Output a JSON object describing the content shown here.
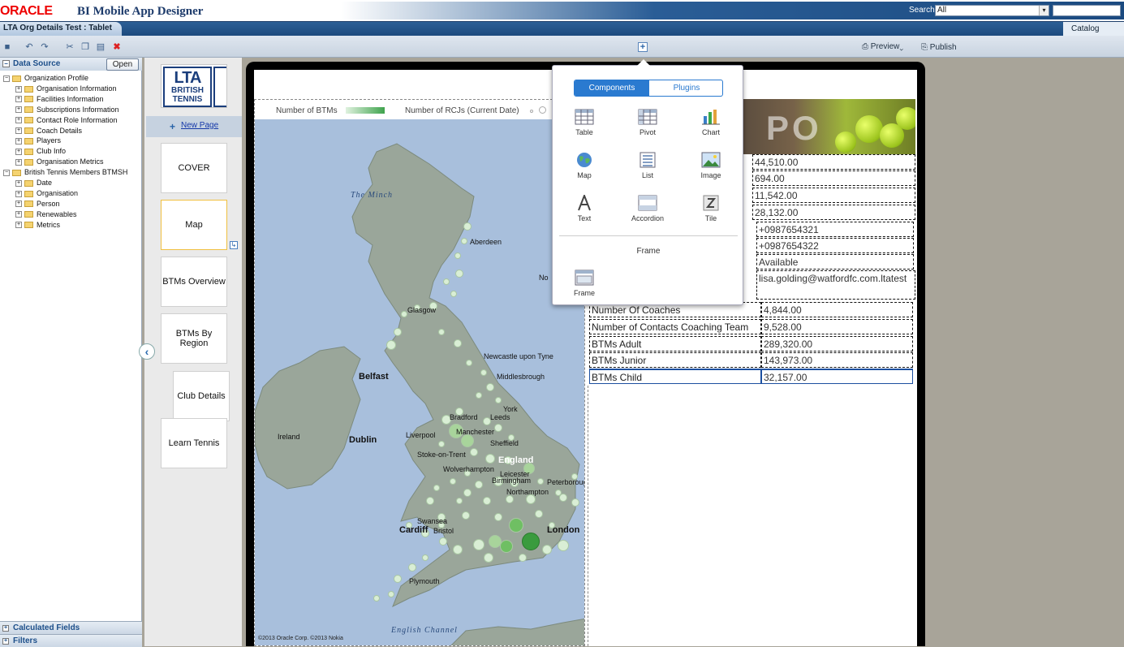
{
  "header": {
    "logo": "ORACLE",
    "app_title": "BI Mobile App Designer",
    "search_label": "Search",
    "search_scope": "All",
    "search_value": ""
  },
  "tabbar": {
    "doc_tab": "LTA Org Details Test : Tablet",
    "catalog": "Catalog"
  },
  "toolbar": {
    "preview_label": "Preview",
    "publish_label": "Publish"
  },
  "data_source": {
    "title": "Data Source",
    "open_label": "Open",
    "tree": [
      {
        "label": "Organization Profile",
        "level": 0,
        "expanded": true
      },
      {
        "label": "Organisation Information",
        "level": 1
      },
      {
        "label": "Facilities Information",
        "level": 1
      },
      {
        "label": "Subscriptions Information",
        "level": 1
      },
      {
        "label": "Contact Role Information",
        "level": 1
      },
      {
        "label": "Coach Details",
        "level": 1
      },
      {
        "label": "Players",
        "level": 1
      },
      {
        "label": "Club Info",
        "level": 1
      },
      {
        "label": "Organisation Metrics",
        "level": 1
      },
      {
        "label": "British Tennis Members BTMSH",
        "level": 0,
        "expanded": true
      },
      {
        "label": "Date",
        "level": 1
      },
      {
        "label": "Organisation",
        "level": 1
      },
      {
        "label": "Person",
        "level": 1
      },
      {
        "label": "Renewables",
        "level": 1
      },
      {
        "label": "Metrics",
        "level": 1
      }
    ],
    "calculated_fields": "Calculated Fields",
    "filters": "Filters"
  },
  "pages": {
    "logo_line1": "LTA",
    "logo_line2": "BRITISH",
    "logo_line3": "TENNIS",
    "new_page": "New Page",
    "items": [
      "COVER",
      "Map",
      "BTMs Overview",
      "BTMs By Region",
      "Club Details",
      "Learn Tennis"
    ]
  },
  "map": {
    "legend_btms": "Number of BTMs",
    "legend_rcjs": "Number of RCJs (Current Date)",
    "labels": {
      "the_minch": "The Minch",
      "aberdeen": "Aberdeen",
      "glasgow": "Glasgow",
      "newcastle": "Newcastle upon Tyne",
      "middlesbrough": "Middlesbrough",
      "belfast": "Belfast",
      "york": "York",
      "bradford": "Bradford",
      "leeds": "Leeds",
      "liverpool": "Liverpool",
      "manchester": "Manchester",
      "sheffield": "Sheffield",
      "ireland": "Ireland",
      "dublin": "Dublin",
      "stoke": "Stoke-on-Trent",
      "wolverhampton": "Wolverhampton",
      "leicester": "Leicester",
      "northampton": "Northampton",
      "peterborough": "Peterborough",
      "england": "England",
      "birmingham": "Birmingham",
      "swansea": "Swansea",
      "cardiff": "Cardiff",
      "bristol": "Bristol",
      "london": "London",
      "plymouth": "Plymouth",
      "english_channel": "English Channel",
      "north": "No",
      "copyright": "©2013 Oracle Corp. ©2013 Nokia"
    }
  },
  "banner": {
    "text": "PO"
  },
  "data_table": {
    "values_top": [
      "44,510.00",
      "694.00",
      "11,542.00",
      "28,132.00",
      "+0987654321",
      "+0987654322",
      "Available",
      "lisa.golding@watfordfc.com.ltatest"
    ],
    "rows": [
      {
        "label": "Number Of Coaches",
        "value": "4,844.00"
      },
      {
        "label": "Number of Contacts Coaching Team",
        "value": "9,528.00"
      },
      {
        "label": "BTMs Adult",
        "value": "289,320.00"
      },
      {
        "label": "BTMs Junior",
        "value": "143,973.00"
      },
      {
        "label": "BTMs Child",
        "value": "32,157.00"
      }
    ]
  },
  "popup": {
    "tab_components": "Components",
    "tab_plugins": "Plugins",
    "components": [
      "Table",
      "Pivot",
      "Chart",
      "Map",
      "List",
      "Image",
      "Text",
      "Accordion",
      "Tile"
    ],
    "frame_heading": "Frame",
    "frame_item": "Frame"
  }
}
